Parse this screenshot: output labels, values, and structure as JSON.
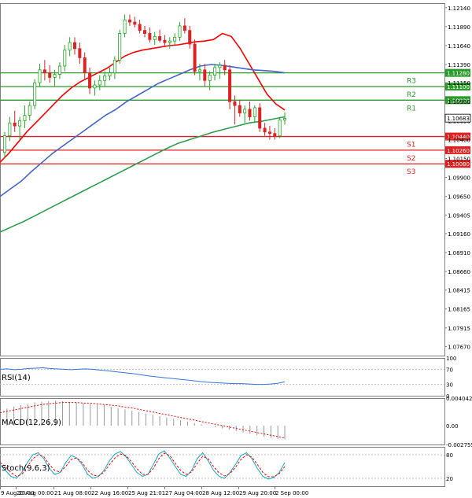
{
  "chart_data": {
    "type": "candlestick",
    "main": {
      "ylim": [
        1.0755,
        1.122
      ],
      "y_ticks": [
        "1.12140",
        "1.11890",
        "1.11640",
        "1.11390",
        "1.11150",
        "1.10900",
        "1.10650",
        "1.10400",
        "1.10150",
        "1.09900",
        "1.09650",
        "1.09405",
        "1.09160",
        "1.08910",
        "1.08660",
        "1.08415",
        "1.08165",
        "1.07915",
        "1.07670"
      ],
      "candles": [
        [
          1.1023,
          1.105,
          1.1015,
          1.1045
        ],
        [
          1.1045,
          1.107,
          1.1038,
          1.1062
        ],
        [
          1.1062,
          1.1078,
          1.105,
          1.1058
        ],
        [
          1.1058,
          1.107,
          1.104,
          1.1065
        ],
        [
          1.1065,
          1.1085,
          1.1055,
          1.1072
        ],
        [
          1.1072,
          1.109,
          1.1065,
          1.1085
        ],
        [
          1.1085,
          1.112,
          1.108,
          1.1115
        ],
        [
          1.1115,
          1.114,
          1.111,
          1.1132
        ],
        [
          1.1132,
          1.1145,
          1.1118,
          1.1128
        ],
        [
          1.1128,
          1.1138,
          1.1115,
          1.1122
        ],
        [
          1.1122,
          1.1132,
          1.111,
          1.1126
        ],
        [
          1.1126,
          1.1142,
          1.112,
          1.1137
        ],
        [
          1.1137,
          1.1165,
          1.113,
          1.1158
        ],
        [
          1.1158,
          1.1175,
          1.115,
          1.1168
        ],
        [
          1.1168,
          1.1175,
          1.1152,
          1.116
        ],
        [
          1.116,
          1.1168,
          1.114,
          1.1148
        ],
        [
          1.1148,
          1.1155,
          1.112,
          1.1128
        ],
        [
          1.1128,
          1.1135,
          1.11,
          1.1108
        ],
        [
          1.1108,
          1.1118,
          1.1098,
          1.1112
        ],
        [
          1.1112,
          1.1125,
          1.1105,
          1.1118
        ],
        [
          1.1118,
          1.113,
          1.111,
          1.1124
        ],
        [
          1.1124,
          1.1135,
          1.1118,
          1.1128
        ],
        [
          1.1128,
          1.115,
          1.112,
          1.1145
        ],
        [
          1.1145,
          1.1185,
          1.114,
          1.118
        ],
        [
          1.118,
          1.1205,
          1.1175,
          1.1198
        ],
        [
          1.1198,
          1.1205,
          1.119,
          1.1195
        ],
        [
          1.1195,
          1.1202,
          1.1188,
          1.1192
        ],
        [
          1.1192,
          1.1198,
          1.118,
          1.1184
        ],
        [
          1.1184,
          1.119,
          1.1175,
          1.118
        ],
        [
          1.118,
          1.1188,
          1.1168,
          1.1172
        ],
        [
          1.1172,
          1.1182,
          1.1165,
          1.1176
        ],
        [
          1.1176,
          1.1185,
          1.1168,
          1.1171
        ],
        [
          1.1171,
          1.1178,
          1.1162,
          1.1168
        ],
        [
          1.1168,
          1.1175,
          1.116,
          1.117
        ],
        [
          1.117,
          1.118,
          1.1165,
          1.1175
        ],
        [
          1.1175,
          1.1195,
          1.117,
          1.119
        ],
        [
          1.119,
          1.12,
          1.118,
          1.1184
        ],
        [
          1.1184,
          1.119,
          1.116,
          1.1166
        ],
        [
          1.1166,
          1.1172,
          1.1125,
          1.113
        ],
        [
          1.113,
          1.114,
          1.1118,
          1.1132
        ],
        [
          1.1132,
          1.114,
          1.111,
          1.1118
        ],
        [
          1.1118,
          1.113,
          1.1105,
          1.1125
        ],
        [
          1.1125,
          1.114,
          1.1118,
          1.1135
        ],
        [
          1.1135,
          1.1142,
          1.112,
          1.1138
        ],
        [
          1.1138,
          1.1145,
          1.1125,
          1.1132
        ],
        [
          1.1132,
          1.1138,
          1.108,
          1.109
        ],
        [
          1.109,
          1.1098,
          1.106,
          1.1085
        ],
        [
          1.1085,
          1.1092,
          1.107,
          1.1075
        ],
        [
          1.1075,
          1.1085,
          1.1062,
          1.108
        ],
        [
          1.108,
          1.109,
          1.1065,
          1.107
        ],
        [
          1.107,
          1.1085,
          1.1062,
          1.1082
        ],
        [
          1.1082,
          1.1088,
          1.105,
          1.1055
        ],
        [
          1.1055,
          1.1062,
          1.1045,
          1.105
        ],
        [
          1.105,
          1.1058,
          1.104,
          1.1048
        ],
        [
          1.1048,
          1.1055,
          1.104,
          1.1045
        ],
        [
          1.1045,
          1.107,
          1.1042,
          1.1066
        ],
        [
          1.1066,
          1.1076,
          1.106,
          1.1068
        ]
      ],
      "moving_averages": [
        {
          "color": "#ff0000",
          "values": [
            1.101,
            1.1022,
            1.1036,
            1.105,
            1.1062,
            1.1074,
            1.1086,
            1.1098,
            1.1108,
            1.1116,
            1.1122,
            1.1128,
            1.1134,
            1.1142,
            1.115,
            1.1155,
            1.1158,
            1.116,
            1.1162,
            1.1164,
            1.1165,
            1.1167,
            1.1169,
            1.117,
            1.1172,
            1.118,
            1.1176,
            1.116,
            1.114,
            1.112,
            1.11,
            1.1087,
            1.1079
          ]
        },
        {
          "color": "#4466cc",
          "values": [
            1.0965,
            1.0975,
            1.0985,
            1.0998,
            1.101,
            1.1022,
            1.1032,
            1.1042,
            1.1052,
            1.1062,
            1.1072,
            1.108,
            1.109,
            1.1098,
            1.1106,
            1.1114,
            1.112,
            1.1126,
            1.1132,
            1.1137,
            1.1139,
            1.1138,
            1.1136,
            1.1134,
            1.1132,
            1.1131,
            1.113,
            1.1128
          ]
        },
        {
          "color": "#2e9e4f",
          "values": [
            1.0918,
            1.0925,
            1.0932,
            1.094,
            1.0948,
            1.0956,
            1.0964,
            1.0972,
            1.098,
            1.0988,
            1.0996,
            1.1004,
            1.1012,
            1.102,
            1.1028,
            1.1035,
            1.104,
            1.1045,
            1.105,
            1.1054,
            1.1058,
            1.1062,
            1.1064,
            1.1067,
            1.107
          ]
        }
      ],
      "levels": [
        {
          "name": "R3",
          "value": 1.1128,
          "price": "1.11280",
          "color": "#2a9a2a"
        },
        {
          "name": "R2",
          "value": 1.111,
          "price": "1.11100",
          "color": "#2a9a2a"
        },
        {
          "name": "R1",
          "value": 1.1092,
          "price": "1.10920",
          "color": "#2a9a2a"
        },
        {
          "name": "S1",
          "value": 1.1044,
          "price": "1.10440",
          "color": "#e02020"
        },
        {
          "name": "S2",
          "value": 1.1026,
          "price": "1.10260",
          "color": "#e02020"
        },
        {
          "name": "S3",
          "value": 1.1008,
          "price": "1.10080",
          "color": "#e02020"
        }
      ],
      "current_price": {
        "value": 1.10683,
        "label": "1.10683"
      }
    },
    "rsi": {
      "label": "RSI(14)",
      "ylim": [
        0,
        100
      ],
      "ticks": [
        "100",
        "70",
        "30",
        "0"
      ],
      "levels": [
        30,
        70
      ],
      "color": "#3377dd",
      "values": [
        70,
        71,
        69,
        70,
        72,
        73,
        74,
        72,
        71,
        70,
        69,
        70,
        71,
        70,
        68,
        66,
        64,
        62,
        60,
        58,
        55,
        52,
        50,
        48,
        46,
        44,
        42,
        40,
        38,
        36,
        35,
        34,
        33,
        32,
        32,
        31,
        30,
        30,
        31,
        33,
        37
      ]
    },
    "macd": {
      "label": "MACD(12,26,9)",
      "ylim": [
        -0.002755,
        0.004042
      ],
      "ticks": [
        "0.004042",
        "0.00",
        "-0.002755"
      ],
      "histogram_color": "#999999",
      "signal_color": "#ff0000",
      "histogram": [
        0.0023,
        0.0025,
        0.0028,
        0.003,
        0.0032,
        0.0034,
        0.0035,
        0.0036,
        0.0037,
        0.0036,
        0.0035,
        0.0034,
        0.0033,
        0.0032,
        0.0031,
        0.003,
        0.0028,
        0.0026,
        0.0024,
        0.0022,
        0.002,
        0.0018,
        0.0016,
        0.0014,
        0.0012,
        0.001,
        0.0008,
        0.0006,
        0.0004,
        0.0002,
        0.0,
        -0.0002,
        -0.0004,
        -0.0006,
        -0.0008,
        -0.001,
        -0.0012,
        -0.0014,
        -0.0016,
        -0.0018,
        -0.0019,
        -0.002
      ],
      "signal": [
        0.0019,
        0.0021,
        0.0023,
        0.0025,
        0.0027,
        0.0029,
        0.0031,
        0.0032,
        0.0033,
        0.0034,
        0.0034,
        0.0034,
        0.0033,
        0.0033,
        0.0032,
        0.0031,
        0.003,
        0.0029,
        0.0027,
        0.0026,
        0.0024,
        0.0022,
        0.002,
        0.0018,
        0.0016,
        0.0014,
        0.0012,
        0.001,
        0.0008,
        0.0006,
        0.0004,
        0.0002,
        0.0,
        -0.0002,
        -0.0004,
        -0.0006,
        -0.0008,
        -0.001,
        -0.0012,
        -0.0014,
        -0.0016,
        -0.0018
      ]
    },
    "stoch": {
      "label": "Stoch(9,6,3)",
      "ylim": [
        0,
        100
      ],
      "ticks": [
        "80",
        "20"
      ],
      "levels": [
        20,
        80
      ],
      "k_color": "#11aacc",
      "d_color": "#ff0000",
      "k": [
        55,
        40,
        25,
        20,
        35,
        60,
        80,
        85,
        70,
        45,
        30,
        35,
        60,
        78,
        72,
        55,
        30,
        20,
        25,
        40,
        65,
        82,
        88,
        75,
        55,
        35,
        25,
        30,
        55,
        82,
        90,
        72,
        50,
        30,
        25,
        40,
        70,
        85,
        65,
        40,
        25,
        20,
        35,
        55,
        78,
        85,
        70,
        45,
        25,
        18,
        22,
        35,
        60
      ],
      "d": [
        60,
        50,
        35,
        25,
        30,
        50,
        70,
        80,
        75,
        55,
        40,
        36,
        50,
        68,
        72,
        60,
        40,
        28,
        26,
        36,
        55,
        72,
        82,
        78,
        62,
        45,
        30,
        30,
        45,
        70,
        84,
        78,
        58,
        40,
        30,
        36,
        58,
        76,
        70,
        50,
        34,
        26,
        32,
        48,
        68,
        80,
        74,
        55,
        35,
        24,
        24,
        32,
        50
      ]
    },
    "x_tick_labels": [
      "9 Aug 20:00",
      "20 Aug 00:00",
      "21 Aug 08:00",
      "22 Aug 16:00",
      "25 Aug 21:01",
      "27 Aug 04:00",
      "28 Aug 12:00",
      "29 Aug 20:00",
      "2 Sep 00:00"
    ]
  }
}
